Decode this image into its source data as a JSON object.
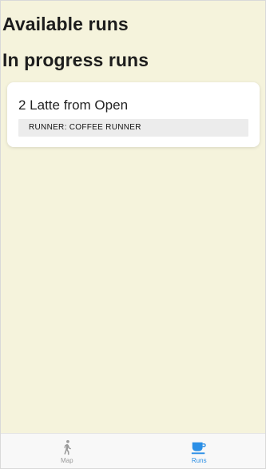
{
  "sections": {
    "available_title": "Available runs",
    "in_progress_title": "In progress runs"
  },
  "in_progress_runs": [
    {
      "title": "2 Latte from Open",
      "runner": "RUNNER: COFFEE RUNNER"
    }
  ],
  "tabbar": {
    "tabs": [
      {
        "label": "Map",
        "icon": "walking-person-icon",
        "active": false
      },
      {
        "label": "Runs",
        "icon": "coffee-cup-icon",
        "active": true
      }
    ]
  },
  "colors": {
    "background": "#f5f3dc",
    "accent": "#2b8fe6",
    "inactive": "#9a9a9a"
  }
}
